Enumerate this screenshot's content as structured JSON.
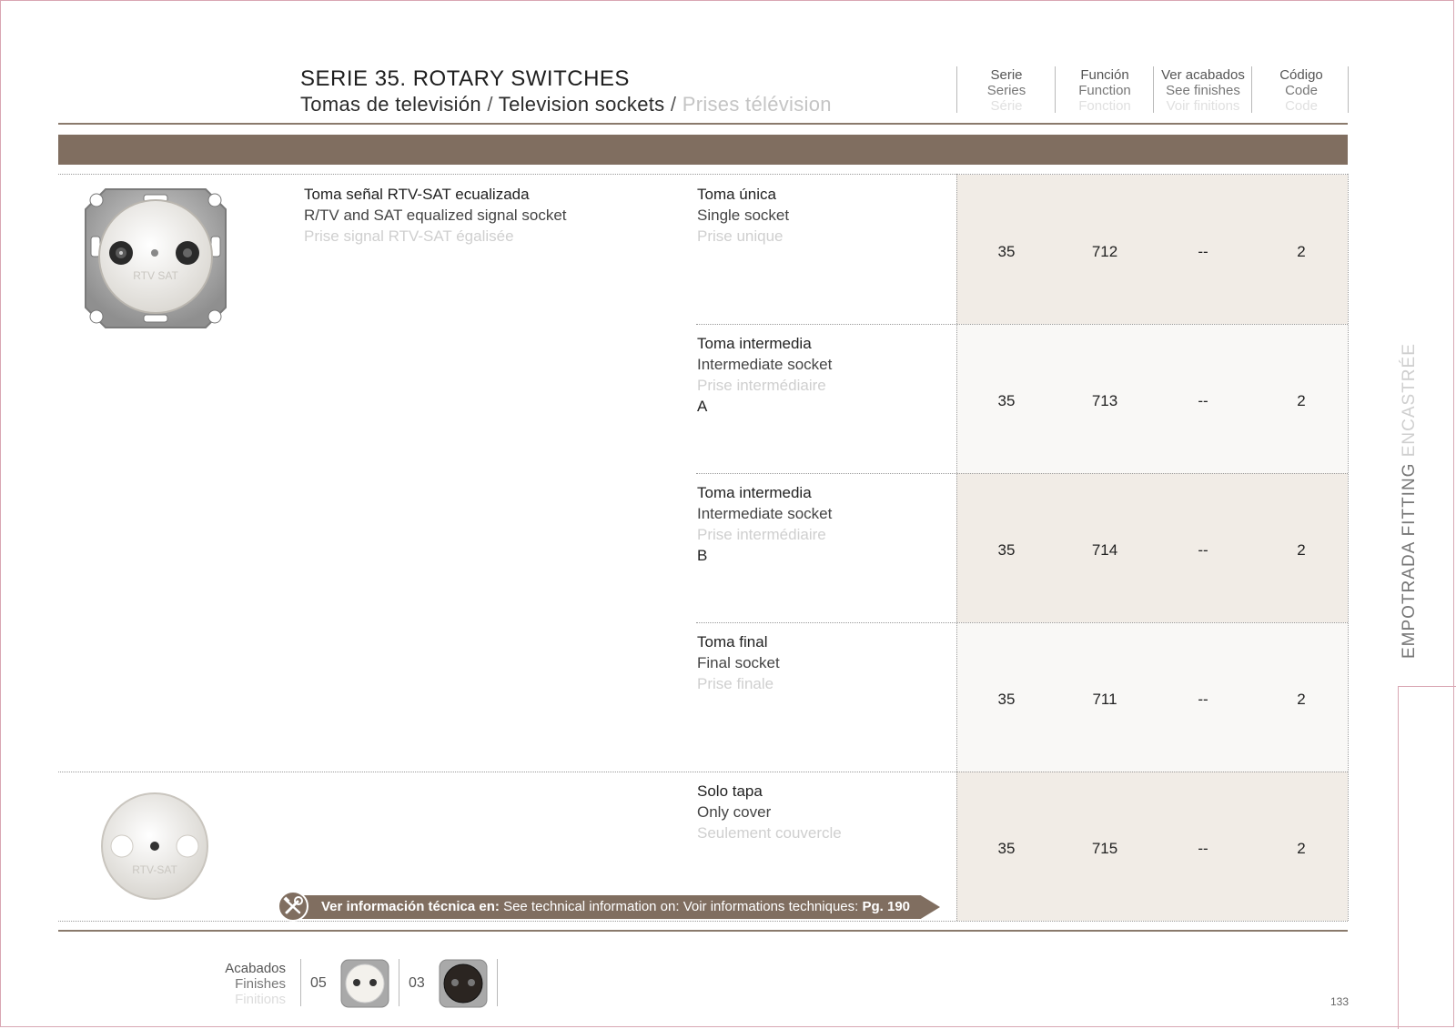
{
  "header": {
    "title": "SERIE 35. ROTARY SWITCHES",
    "subtitle_es": "Tomas de televisión",
    "subtitle_sep1": " / ",
    "subtitle_en": "Television sockets",
    "subtitle_sep2": " / ",
    "subtitle_fr": "Prises télévision"
  },
  "columns": [
    {
      "es": "Serie",
      "en": "Series",
      "fr": "Série"
    },
    {
      "es": "Función",
      "en": "Function",
      "fr": "Fonction"
    },
    {
      "es": "Ver acabados",
      "en": "See finishes",
      "fr": "Voir finitions"
    },
    {
      "es": "Código",
      "en": "Code",
      "fr": "Code"
    }
  ],
  "product": {
    "es": "Toma señal RTV-SAT ecualizada",
    "en": "R/TV and SAT equalized signal socket",
    "fr": "Prise signal RTV-SAT égalisée",
    "image_label": "RTV SAT"
  },
  "rows": [
    {
      "es": "Toma única",
      "en": "Single socket",
      "fr": "Prise unique",
      "extra": "",
      "serie": "35",
      "funcion": "712",
      "acabados": "--",
      "codigo": "2"
    },
    {
      "es": "Toma intermedia",
      "en": "Intermediate socket",
      "fr": "Prise intermédiaire",
      "extra": "A",
      "serie": "35",
      "funcion": "713",
      "acabados": "--",
      "codigo": "2"
    },
    {
      "es": "Toma intermedia",
      "en": "Intermediate socket",
      "fr": "Prise intermédiaire",
      "extra": "B",
      "serie": "35",
      "funcion": "714",
      "acabados": "--",
      "codigo": "2"
    },
    {
      "es": "Toma final",
      "en": "Final socket",
      "fr": "Prise finale",
      "extra": "",
      "serie": "35",
      "funcion": "711",
      "acabados": "--",
      "codigo": "2"
    },
    {
      "es": "Solo tapa",
      "en": "Only cover",
      "fr": "Seulement couvercle",
      "extra": "",
      "serie": "35",
      "funcion": "715",
      "acabados": "--",
      "codigo": "2"
    }
  ],
  "cover_image_label": "RTV-SAT",
  "tech_info": {
    "es": "Ver información técnica en:",
    "en": " See technical information on:",
    "fr": " Voir informations techniques:",
    "page": " Pg. 190"
  },
  "finishes": {
    "es": "Acabados",
    "en": "Finishes",
    "fr": "Finitions",
    "items": [
      {
        "code": "05",
        "color": "white"
      },
      {
        "code": "03",
        "color": "black"
      }
    ]
  },
  "page_number": "133",
  "side_tab": {
    "dark": "EMPOTRADA FITTING",
    "light": " ENCASTRÉE"
  },
  "colors": {
    "brand_brown": "#806e60",
    "row_shade": "#f1ece6",
    "border_pink": "#d9a7b3"
  }
}
